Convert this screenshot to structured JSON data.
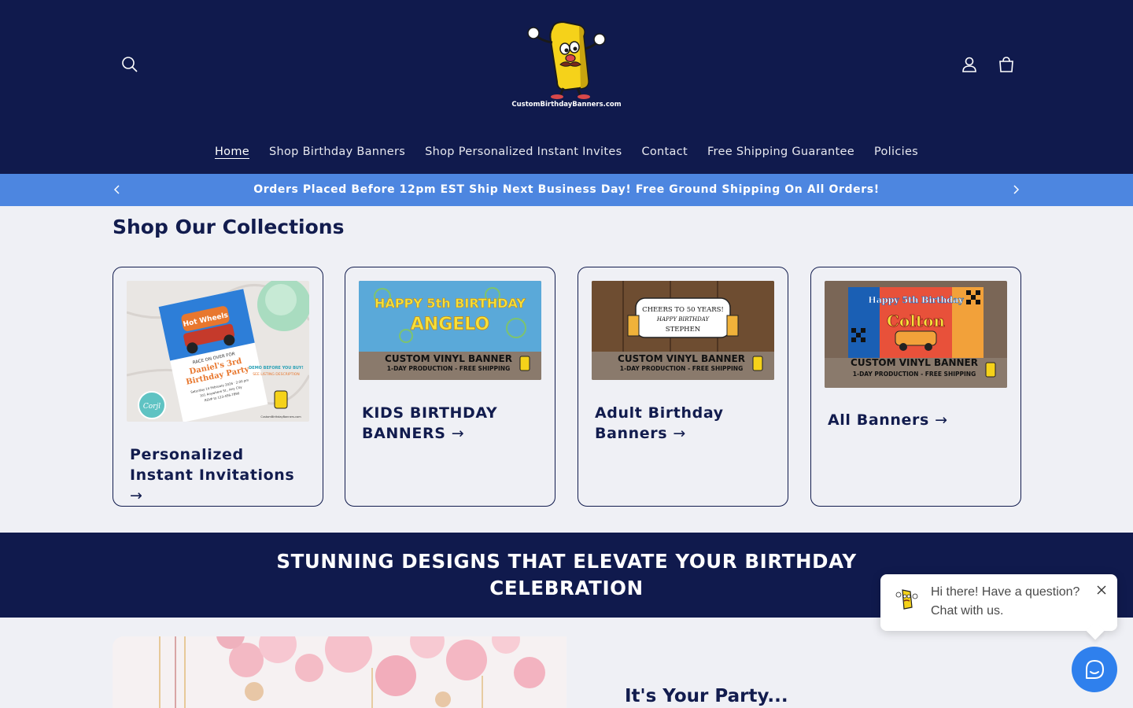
{
  "header": {
    "logo_text": "CustomBirthdayBanners.com",
    "search_icon": "search-icon",
    "account_icon": "user-icon",
    "cart_icon": "bag-icon"
  },
  "nav": {
    "items": [
      {
        "label": "Home",
        "active": true
      },
      {
        "label": "Shop Birthday Banners"
      },
      {
        "label": "Shop Personalized Instant Invites"
      },
      {
        "label": "Contact"
      },
      {
        "label": "Free Shipping Guarantee"
      },
      {
        "label": "Policies"
      }
    ]
  },
  "announcement": {
    "text": "Orders Placed Before 12pm EST Ship Next Business Day! Free Ground Shipping On All Orders!",
    "color": "#4d86e0"
  },
  "collections": {
    "title": "Shop Our Collections",
    "cards": [
      {
        "title": "Personalized Instant Invitations",
        "arrow": "→",
        "img": {
          "t1": "RACE ON OVER FOR",
          "t2": "Daniel's 3rd",
          "t3": "Birthday Party",
          "t4": "Saturday 14 February 2026 · 2:00 pm",
          "t5": "101 Anywhere St., Any City",
          "t6": "RSVP to 123-456-7890",
          "t7": "DEMO BEFORE YOU BUY!",
          "t8": "SEE LISTING DESCRIPTION",
          "t9": "Corjl",
          "t10": "CustomBirthdayBanners.com",
          "brand": "Hot Wheels"
        }
      },
      {
        "title": "KIDS BIRTHDAY BANNERS",
        "arrow": "→",
        "img": {
          "t1": "HAPPY 5th BIRTHDAY",
          "t2": "ANGELO",
          "t3": "CUSTOM VINYL BANNER",
          "t4": "1-DAY PRODUCTION - FREE SHIPPING"
        }
      },
      {
        "title": "Adult Birthday Banners",
        "arrow": "→",
        "img": {
          "t1": "CHEERS TO 50 YEARS!",
          "t2": "HAPPY BIRTHDAY",
          "t3": "STEPHEN",
          "t4": "CUSTOM VINYL BANNER",
          "t5": "1-DAY PRODUCTION - FREE SHIPPING"
        }
      },
      {
        "title": "All Banners",
        "arrow": "→",
        "img": {
          "t1": "Happy 5th Birthday",
          "t2": "Colton",
          "t3": "CUSTOM VINYL BANNER",
          "t4": "1-DAY PRODUCTION - FREE SHIPPING"
        }
      }
    ]
  },
  "stripe": {
    "text": "STUNNING DESIGNS THAT ELEVATE YOUR BIRTHDAY CELEBRATION"
  },
  "feature": {
    "title": "It's Your Party..."
  },
  "chat": {
    "message": "Hi there! Have a question? Chat with us.",
    "fab_color": "#2f80ed"
  }
}
